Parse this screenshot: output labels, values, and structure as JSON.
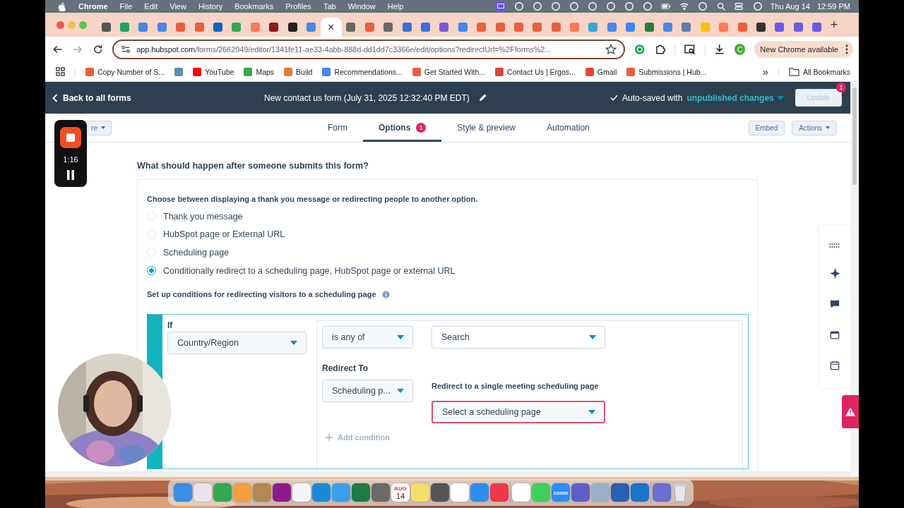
{
  "menu_bar": {
    "app": "Chrome",
    "items": [
      "File",
      "Edit",
      "View",
      "History",
      "Bookmarks",
      "Profiles",
      "Tab",
      "Window",
      "Help"
    ],
    "status_icons": [
      {
        "kind": "screen"
      },
      {
        "kind": "circle"
      },
      {
        "kind": "circle"
      },
      {
        "kind": "circle"
      },
      {
        "kind": "circle"
      },
      {
        "kind": "circle"
      },
      {
        "kind": "circle"
      },
      {
        "kind": "circle"
      },
      {
        "kind": "circle"
      },
      {
        "kind": "battery"
      },
      {
        "kind": "wifi"
      },
      {
        "kind": "circle"
      },
      {
        "kind": "search"
      },
      {
        "kind": "toggle"
      },
      {
        "kind": "circle"
      }
    ],
    "date": "Thu Aug 14",
    "time": "12:59 PM"
  },
  "browser_tabs": [
    {
      "color": "#555555",
      "selected": false
    },
    {
      "color": "#1ea362",
      "selected": false
    },
    {
      "color": "#4a86e8",
      "selected": false
    },
    {
      "color": "#4a86e8",
      "selected": false
    },
    {
      "color": "#e8603c",
      "selected": false
    },
    {
      "color": "#e8603c",
      "selected": false
    },
    {
      "color": "#0a66c2",
      "selected": false
    },
    {
      "color": "#34a853",
      "selected": false
    },
    {
      "color": "#ff7a59",
      "selected": false
    },
    {
      "color": "#8b1a1a",
      "selected": false
    },
    {
      "color": "#222222",
      "selected": false
    },
    {
      "color": "#4a86e8",
      "selected": false
    },
    {
      "selected": true
    },
    {
      "color": "#666666",
      "selected": false
    },
    {
      "color": "#e8603c",
      "selected": false
    },
    {
      "color": "#666666",
      "selected": false
    },
    {
      "color": "#3b6fd8",
      "selected": false
    },
    {
      "color": "#3b6fd8",
      "selected": false
    },
    {
      "color": "#7b5cd6",
      "selected": false
    },
    {
      "color": "#4285f4",
      "selected": false
    },
    {
      "color": "#e8603c",
      "selected": false
    },
    {
      "color": "#e8603c",
      "selected": false
    },
    {
      "color": "#e8603c",
      "selected": false
    },
    {
      "color": "#e8603c",
      "selected": false
    },
    {
      "color": "#e8603c",
      "selected": false
    },
    {
      "color": "#ff7a59",
      "selected": false
    },
    {
      "color": "#33a6d6",
      "selected": false
    },
    {
      "color": "#4a86e8",
      "selected": false
    },
    {
      "color": "#4285f4",
      "selected": false
    },
    {
      "color": "#2a7a3a",
      "selected": false
    },
    {
      "color": "#4a86e8",
      "selected": false
    },
    {
      "color": "#5b7fa8",
      "selected": false
    },
    {
      "color": "#f5c400",
      "selected": false
    },
    {
      "color": "#ff7a59",
      "selected": false
    },
    {
      "color": "#e8603c",
      "selected": false
    },
    {
      "color": "#333333",
      "selected": false
    },
    {
      "color": "#6b5ce7",
      "selected": false
    },
    {
      "color": "#6b5ce7",
      "selected": false
    },
    {
      "color": "#6b5ce7",
      "selected": false
    }
  ],
  "close_glyph": "×",
  "new_tab": "+",
  "address_bar": {
    "host": "app.hubspot.com",
    "path": "/forms/2662049/editor/1341fe11-ae33-4abb-888d-dd1dd7c3366e/edit/options?redirectUrl=%2Fforms%2..."
  },
  "profile_initial": "C",
  "update_pill": "New Chrome available",
  "bookmarks": [
    {
      "label": "Copy Number of S...",
      "color": "#e8603c"
    },
    {
      "color": "#5b8fb0"
    },
    {
      "label": "YouTube",
      "color": "#ff0000"
    },
    {
      "label": "Maps",
      "color": "#34a853"
    },
    {
      "label": "Build",
      "color": "#e0793a"
    },
    {
      "label": "Recommendations...",
      "color": "#4285f4"
    },
    {
      "label": "Get Started With...",
      "color": "#e8603c"
    },
    {
      "label": "Contact Us | Ergos...",
      "color": "#d9453a"
    },
    {
      "label": "Gmail",
      "color": "#ea4335"
    },
    {
      "label": "Submissions | Hub...",
      "color": "#e8603c"
    }
  ],
  "bookmarks_overflow": "»",
  "all_bookmarks": "All Bookmarks",
  "header": {
    "back": "Back to all forms",
    "title": "New contact us form (July 31, 2025 12:32:40 PM EDT)",
    "autosave": "Auto-saved with",
    "changes": "unpublished changes",
    "update": "Update",
    "update_badge": "1"
  },
  "nav": {
    "left_button": "re",
    "tabs": [
      {
        "label": "Form",
        "selected": false
      },
      {
        "label": "Options",
        "selected": true,
        "badge": "1"
      },
      {
        "label": "Style & preview",
        "selected": false
      },
      {
        "label": "Automation",
        "selected": false
      }
    ],
    "embed": "Embed",
    "actions": "Actions"
  },
  "recorder": {
    "elapsed": "1:16"
  },
  "content": {
    "heading": "What should happen after someone submits this form?",
    "instruction": "Choose between displaying a thank you message or redirecting people to another option.",
    "options": [
      {
        "label": "Thank you message",
        "selected": false
      },
      {
        "label": "HubSpot page or External URL",
        "selected": false
      },
      {
        "label": "Scheduling page",
        "selected": false
      },
      {
        "label": "Conditionally redirect to a scheduling page, HubSpot page or external URL",
        "selected": true
      }
    ],
    "conditions_label": "Set up conditions for redirecting visitors to a scheduling page",
    "condition": {
      "if_label": "If",
      "property": "Country/Region",
      "operator": "is any of",
      "value_placeholder": "Search",
      "redirect_label": "Redirect To",
      "redirect_type": "Scheduling p...",
      "target_label": "Redirect to a single meeting scheduling page",
      "target": "Select a scheduling page",
      "add": "Add condition"
    }
  },
  "dock": [
    {
      "kind": "app",
      "color": "#3a8ee6"
    },
    {
      "kind": "app",
      "color": "#e9e3ee"
    },
    {
      "kind": "app",
      "color": "#34a853"
    },
    {
      "kind": "app",
      "color": "#f0a040"
    },
    {
      "kind": "app",
      "color": "#b08a50"
    },
    {
      "kind": "app",
      "color": "#8e1a8a"
    },
    {
      "kind": "app",
      "color": "#f4f4f4"
    },
    {
      "kind": "app",
      "color": "#1b8ad6"
    },
    {
      "kind": "app",
      "color": "#3aa0e8"
    },
    {
      "kind": "app",
      "color": "#1f7a45"
    },
    {
      "kind": "app",
      "color": "#6a6a6a"
    },
    {
      "kind": "calendar",
      "month": "AUG",
      "day": "14"
    },
    {
      "kind": "app",
      "color": "#f7dd6a"
    },
    {
      "kind": "app",
      "color": "#555555"
    },
    {
      "kind": "app",
      "color": "#ffffff"
    },
    {
      "kind": "app",
      "color": "#2f8cf0"
    },
    {
      "kind": "app",
      "color": "#f0384d"
    },
    {
      "kind": "separator"
    },
    {
      "kind": "app",
      "color": "#ffffff"
    },
    {
      "kind": "app",
      "color": "#3ecf5a"
    },
    {
      "kind": "app",
      "color": "#2d8cff",
      "label": "zoom"
    },
    {
      "kind": "app",
      "color": "#5b5fc7"
    },
    {
      "kind": "app",
      "color": "#9ab0c8"
    },
    {
      "kind": "app",
      "color": "#2b5fb4"
    },
    {
      "kind": "app",
      "color": "#1a73c8"
    },
    {
      "kind": "separator"
    },
    {
      "kind": "app",
      "color": "#6a6fd0"
    },
    {
      "kind": "trash"
    }
  ]
}
